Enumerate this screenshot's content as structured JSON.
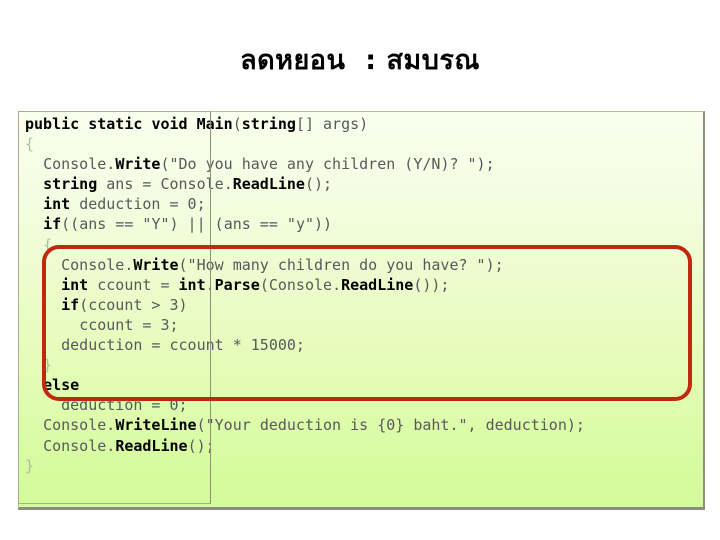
{
  "slide": {
    "title": "ลดหยอน  : สมบรณ",
    "background_color": "#ffffff"
  },
  "code_panel": {
    "language": "csharp",
    "background_top_color": "#fbffee",
    "background_bottom_color": "#d3fa9c",
    "border_color": "#8d8f7e",
    "text_color": "#58595b",
    "keyword_color": "#000000",
    "lines": [
      {
        "id": "line-1",
        "indent": 0,
        "text": "public static void Main(string[] args)"
      },
      {
        "id": "line-2",
        "indent": 0,
        "text": "{"
      },
      {
        "id": "line-3",
        "indent": 1,
        "text": "Console.Write(\"Do you have any children (Y/N)? \");"
      },
      {
        "id": "line-4",
        "indent": 1,
        "text": "string ans = Console.ReadLine();"
      },
      {
        "id": "line-5",
        "indent": 1,
        "text": "int deduction = 0;"
      },
      {
        "id": "line-6",
        "indent": 1,
        "text": "if((ans == \"Y\") || (ans == \"y\"))"
      },
      {
        "id": "line-7",
        "indent": 1,
        "text": "{"
      },
      {
        "id": "line-8",
        "indent": 2,
        "text": "Console.Write(\"How many children do you have? \");"
      },
      {
        "id": "line-9",
        "indent": 2,
        "text": "int ccount = int.Parse(Console.ReadLine());"
      },
      {
        "id": "line-10",
        "indent": 2,
        "text": "if(ccount > 3)"
      },
      {
        "id": "line-11",
        "indent": 3,
        "text": "ccount = 3;"
      },
      {
        "id": "line-12",
        "indent": 2,
        "text": "deduction = ccount * 15000;"
      },
      {
        "id": "line-13",
        "indent": 1,
        "text": "}"
      },
      {
        "id": "line-14",
        "indent": 1,
        "text": "else"
      },
      {
        "id": "line-15",
        "indent": 2,
        "text": "deduction = 0;"
      },
      {
        "id": "line-16",
        "indent": 1,
        "text": "Console.WriteLine(\"Your deduction is {0} baht.\", deduction);"
      },
      {
        "id": "line-17",
        "indent": 1,
        "text": "Console.ReadLine();"
      },
      {
        "id": "line-18",
        "indent": 0,
        "text": "}"
      }
    ]
  },
  "annotations": {
    "highlight_oval": {
      "name": "red-rounded-highlight",
      "color": "#c0290d",
      "covers_lines": [
        "line-7",
        "line-8",
        "line-9",
        "line-10",
        "line-11",
        "line-12",
        "line-13"
      ]
    },
    "caret": {
      "name": "text-insertion-caret",
      "color": "#8e9275"
    }
  }
}
